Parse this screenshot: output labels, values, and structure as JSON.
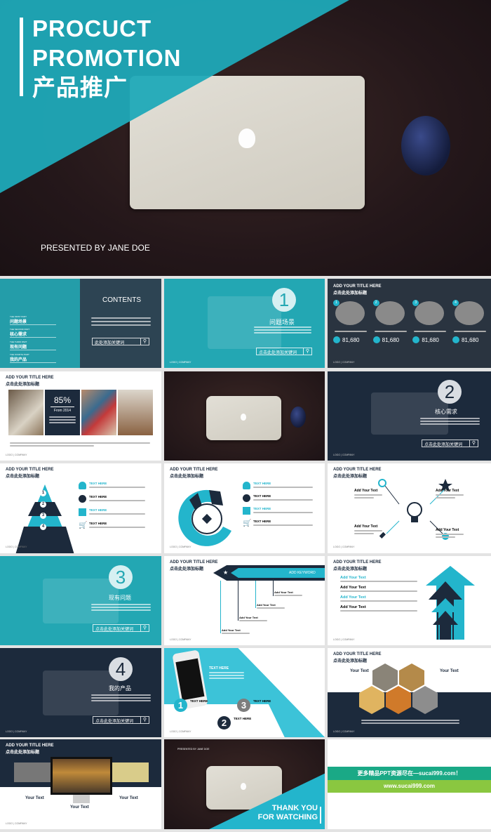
{
  "hero": {
    "title_lines": [
      "PROCUCT",
      "PROMOTION"
    ],
    "title_cn": "产品推广",
    "presenter": "PRESENTED BY JANE DOE"
  },
  "common": {
    "add_title": "ADD YOUR TITLE HERE",
    "cn_title": "点击此处添加标题",
    "logo": "LOGO | COMPANY",
    "search_placeholder": "点击此处添加关键词",
    "text_here": "TEXT HERE",
    "add_your_text": "Add Your Text",
    "your_text": "Your Text"
  },
  "contents": {
    "heading": "CONTENTS",
    "items": [
      {
        "part": "THE FIRST PART",
        "label": "问题场景"
      },
      {
        "part": "THE SECOND PART",
        "label": "核心需求"
      },
      {
        "part": "THE THIRD PART",
        "label": "现有问题"
      },
      {
        "part": "THE FOURTH PART",
        "label": "我的产品"
      }
    ],
    "search_placeholder": "此处添加关键词"
  },
  "sections": [
    {
      "num": "1",
      "title": "问题场景"
    },
    {
      "num": "2",
      "title": "核心需求"
    },
    {
      "num": "3",
      "title": "现有问题"
    },
    {
      "num": "4",
      "title": "我的产品"
    }
  ],
  "stats": {
    "items": [
      {
        "num": "1",
        "value": "81,680"
      },
      {
        "num": "2",
        "value": "81,680"
      },
      {
        "num": "3",
        "value": "81,680"
      },
      {
        "num": "4",
        "value": "81,680"
      }
    ]
  },
  "percent": {
    "value": "85%",
    "since": "From 2014"
  },
  "pyramid": {
    "levels": [
      "1",
      "2",
      "3",
      "4"
    ]
  },
  "keyword": {
    "label": "ADD KEYWORD"
  },
  "phone": {
    "cn_title": "点击此处添加标题",
    "title_here": "TITLE HERE",
    "steps": [
      "1",
      "3",
      "2"
    ]
  },
  "thanks": {
    "line1": "THANK YOU",
    "line2": "FOR WATCHING"
  },
  "ad": {
    "line1": "更多精品PPT资源尽在—sucai999.com！",
    "line2": "www.sucai999.com",
    "color1": "#1aa986",
    "color2": "#8ac740"
  },
  "colors": {
    "teal": "#23a7b3",
    "navy": "#1c2a3c",
    "cyan": "#3cc3d8"
  }
}
